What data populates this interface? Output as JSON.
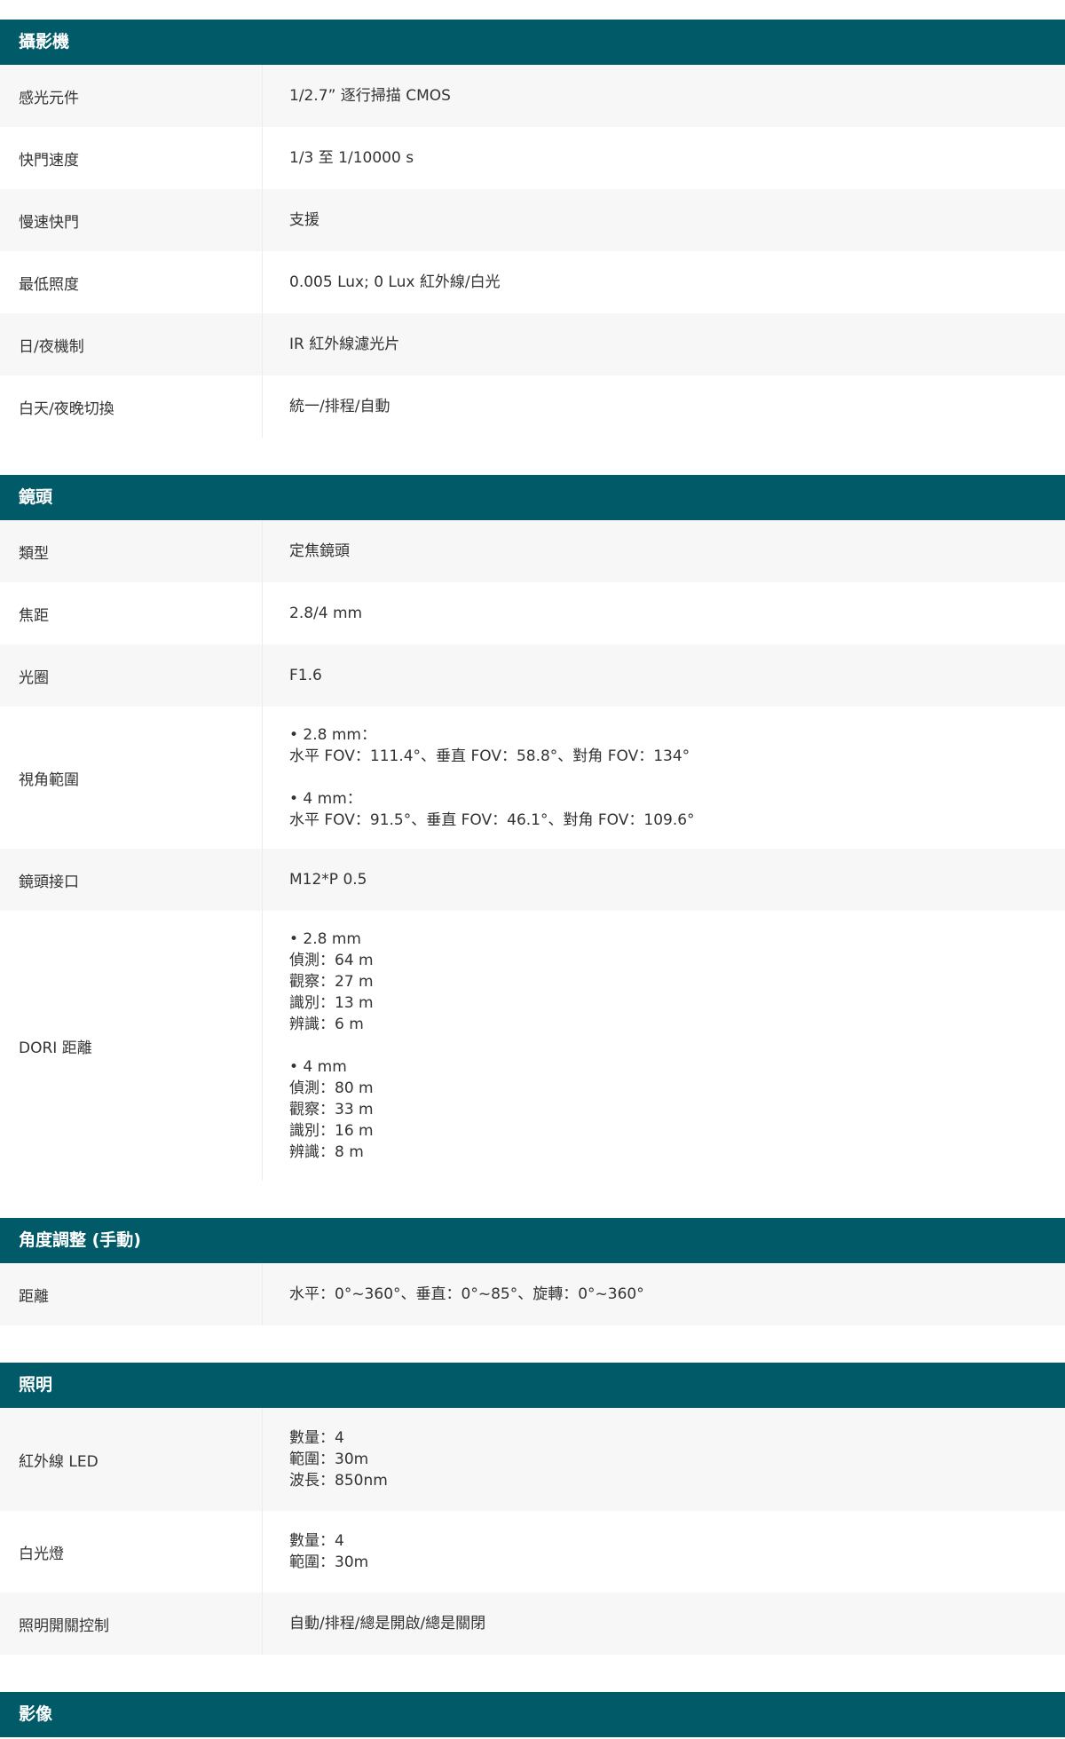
{
  "sections": [
    {
      "title": "攝影機",
      "rows": [
        {
          "label": "感光元件",
          "lines": [
            "1/2.7” 逐行掃描 CMOS"
          ]
        },
        {
          "label": "快門速度",
          "lines": [
            "1/3 至 1/10000 s"
          ]
        },
        {
          "label": "慢速快門",
          "lines": [
            "支援"
          ]
        },
        {
          "label": "最低照度",
          "lines": [
            "0.005 Lux; 0 Lux 紅外線/白光"
          ]
        },
        {
          "label": "日/夜機制",
          "lines": [
            "IR 紅外線濾光片"
          ]
        },
        {
          "label": "白天/夜晚切換",
          "lines": [
            "統一/排程/自動"
          ]
        }
      ]
    },
    {
      "title": "鏡頭",
      "rows": [
        {
          "label": "類型",
          "lines": [
            "定焦鏡頭"
          ]
        },
        {
          "label": "焦距",
          "lines": [
            "2.8/4 mm"
          ]
        },
        {
          "label": "光圈",
          "lines": [
            "F1.6"
          ]
        },
        {
          "label": "視角範圍",
          "lines": [
            "• 2.8 mm：",
            "水平 FOV：111.4°、垂直 FOV：58.8°、對角 FOV：134°",
            "",
            "• 4 mm：",
            "水平 FOV：91.5°、垂直 FOV：46.1°、對角 FOV：109.6°"
          ]
        },
        {
          "label": "鏡頭接口",
          "lines": [
            "M12*P 0.5"
          ]
        },
        {
          "label": "DORI 距離",
          "lines": [
            "• 2.8 mm",
            "偵測：64 m",
            "觀察：27 m",
            "識別：13 m",
            "辨識：6 m",
            "",
            "• 4 mm",
            "偵測：80 m",
            "觀察：33 m",
            "識別：16 m",
            "辨識：8 m"
          ]
        }
      ]
    },
    {
      "title": "角度調整 (手動)",
      "rows": [
        {
          "label": "距離",
          "lines": [
            "水平：0°~360°、垂直：0°~85°、旋轉：0°~360°"
          ]
        }
      ]
    },
    {
      "title": "照明",
      "rows": [
        {
          "label": "紅外線 LED",
          "lines": [
            "數量：4",
            "範圍：30m",
            "波長：850nm"
          ]
        },
        {
          "label": "白光燈",
          "lines": [
            "數量：4",
            "範圍：30m"
          ]
        },
        {
          "label": "照明開關控制",
          "lines": [
            "自動/排程/總是開啟/總是關閉"
          ]
        }
      ]
    },
    {
      "title": "影像",
      "rows": []
    }
  ]
}
